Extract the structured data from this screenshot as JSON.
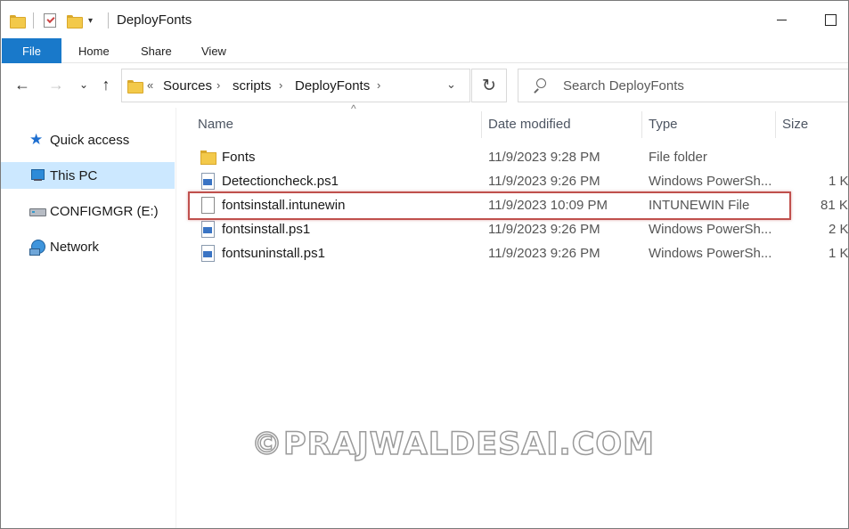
{
  "window": {
    "title": "DeployFonts"
  },
  "ribbon": {
    "tabs": [
      "File",
      "Home",
      "Share",
      "View"
    ]
  },
  "address": {
    "overflow": "«",
    "crumbs": [
      "Sources",
      "scripts",
      "DeployFonts"
    ]
  },
  "search": {
    "placeholder": "Search DeployFonts"
  },
  "sidebar": {
    "items": [
      {
        "label": "Quick access",
        "icon": "quick-access-star-icon"
      },
      {
        "label": "This PC",
        "icon": "this-pc-icon",
        "selected": true
      },
      {
        "label": "CONFIGMGR (E:)",
        "icon": "drive-icon"
      },
      {
        "label": "Network",
        "icon": "network-icon"
      }
    ]
  },
  "columns": {
    "name": "Name",
    "date": "Date modified",
    "type": "Type",
    "size": "Size"
  },
  "files": [
    {
      "name": "Fonts",
      "date": "11/9/2023 9:28 PM",
      "type": "File folder",
      "size": "",
      "icon": "folder-icon"
    },
    {
      "name": "Detectioncheck.ps1",
      "date": "11/9/2023 9:26 PM",
      "type": "Windows PowerSh...",
      "size": "1 K",
      "icon": "powershell-file-icon"
    },
    {
      "name": "fontsinstall.intunewin",
      "date": "11/9/2023 10:09 PM",
      "type": "INTUNEWIN File",
      "size": "81 K",
      "icon": "blank-file-icon"
    },
    {
      "name": "fontsinstall.ps1",
      "date": "11/9/2023 9:26 PM",
      "type": "Windows PowerSh...",
      "size": "2 K",
      "icon": "powershell-file-icon"
    },
    {
      "name": "fontsuninstall.ps1",
      "date": "11/9/2023 9:26 PM",
      "type": "Windows PowerSh...",
      "size": "1 K",
      "icon": "powershell-file-icon"
    }
  ],
  "colors": {
    "accent": "#1979ca",
    "selection": "#cce8ff",
    "highlight_box": "#c0504d"
  },
  "watermark": "©PRAJWALDESAI.COM"
}
